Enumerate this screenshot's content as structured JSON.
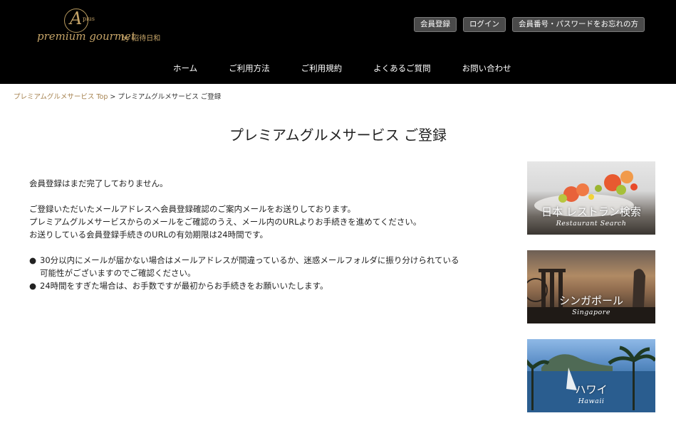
{
  "brand": {
    "mark": "A",
    "mark_plus": "plus",
    "name": "premium gourmet",
    "by": "by 招待日和",
    "gold": "#c5a468"
  },
  "top_buttons": [
    "会員登録",
    "ログイン",
    "会員番号・パスワードをお忘れの方"
  ],
  "nav": [
    "ホーム",
    "ご利用方法",
    "ご利用規約",
    "よくあるご質問",
    "お問い合わせ"
  ],
  "breadcrumb": {
    "link": "プレミアムグルメサービス Top",
    "separator": ">",
    "current": "プレミアムグルメサービス ご登録"
  },
  "page_title": "プレミアムグルメサービス ご登録",
  "body": {
    "line1": "会員登録はまだ完了しておりません。",
    "line2": "ご登録いただいたメールアドレスへ会員登録確認のご案内メールをお送りしております。",
    "line3": "プレミアムグルメサービスからのメールをご確認のうえ、メール内のURLよりお手続きを進めてください。",
    "line4": "お送りしている会員登録手続きのURLの有効期限は24時間です。",
    "bullet_symbol": "●",
    "bullet1_line1": "30分以内にメールが届かない場合はメールアドレスが間違っているか、迷惑メールフォルダに振り分けられている",
    "bullet1_line2": "可能性がございますのでご確認ください。",
    "bullet2": "24時間をすぎた場合は、お手数ですが最初からお手続きをお願いいたします。"
  },
  "banners": [
    {
      "ja": "日本 レストラン検索",
      "en": "Restaurant Search"
    },
    {
      "ja": "シンガポール",
      "en": "Singapore"
    },
    {
      "ja": "ハワイ",
      "en": "Hawaii"
    }
  ]
}
